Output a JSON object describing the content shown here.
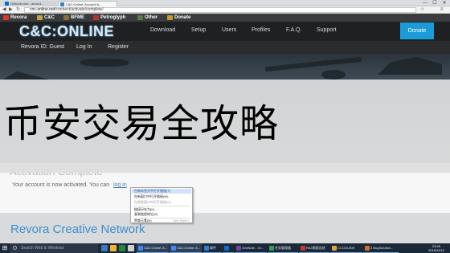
{
  "browser": {
    "tabs": [
      {
        "label": "Outlook.com - anna.d..."
      },
      {
        "label": "C&C:Online: Account A..."
      }
    ],
    "url_host": "cnc-online.net",
    "url_path": "/connect/activate/complete/",
    "window_controls": [
      "—",
      "☐",
      "✕"
    ]
  },
  "bookmarks": [
    {
      "label": "Revora",
      "color": "#e0342c"
    },
    {
      "label": "C&C",
      "color": "#c7a14a"
    },
    {
      "label": "BFME",
      "color": "#8a6d3b"
    },
    {
      "label": "Petroglyph",
      "color": "#b5332d"
    },
    {
      "label": "Other",
      "color": "#5b7c3a"
    },
    {
      "label": "Donate",
      "color": "#c79a2c"
    }
  ],
  "site": {
    "logo": "C&C:ONLINE",
    "nav": [
      "Download",
      "Setup",
      "Users",
      "Profiles",
      "F.A.Q.",
      "Support"
    ],
    "donate": "Donate",
    "subnav": [
      "Revora ID: Guest",
      "Log In",
      "Register"
    ],
    "overlay_text": "币安交易全攻略",
    "activation_title": "Activation Complete",
    "activation_msg": "Your account is now activated. You can",
    "activation_link": "log in",
    "footer_title": "Revora Creative Network"
  },
  "context_menu": [
    {
      "label": "在新标签页中打开链接(T)",
      "state": "highlight",
      "key": ""
    },
    {
      "label": "在新窗口中打开链接(W)",
      "state": "normal",
      "key": ""
    },
    {
      "label": "在隐身窗口中打开链接(G)",
      "state": "disabled",
      "key": ""
    },
    {
      "label": "链接另存为(K)...",
      "state": "normal",
      "key": ""
    },
    {
      "label": "复制链接地址(E)",
      "state": "normal",
      "key": ""
    },
    {
      "label": "审查元素(N)",
      "state": "normal",
      "key": "Ctrl+Shift+I"
    }
  ],
  "taskbar": {
    "start": "⊞",
    "search_placeholder": "Search Web & Windows",
    "pinned_colors": [
      "#3a79c4",
      "#f0b429",
      "#1e8a3c",
      "#d0d0d0"
    ],
    "apps": [
      {
        "label": "C&C:Online: A...",
        "color": "#4285f4",
        "active": true
      },
      {
        "label": "C&C:Online: A...",
        "color": "#4285f4",
        "active": true
      },
      {
        "label": "邮件",
        "color": "#2d7fd1",
        "active": false
      },
      {
        "label": "",
        "color": "#0a6ccc",
        "active": false
      },
      {
        "label": "OneNote - Or...",
        "color": "#7b3fa0",
        "active": false
      },
      {
        "label": "任务管理器",
        "color": "#3c9a57",
        "active": false
      },
      {
        "label": "RA3周报总结",
        "color": "#c23b3b",
        "active": false
      },
      {
        "label": "CCOGUIDE",
        "color": "#e0a63c",
        "active": false
      },
      {
        "label": "3 BugSolution...",
        "color": "#d46b2c",
        "active": false
      }
    ],
    "clock_time": "23:26",
    "clock_date": "2015/11/12"
  }
}
